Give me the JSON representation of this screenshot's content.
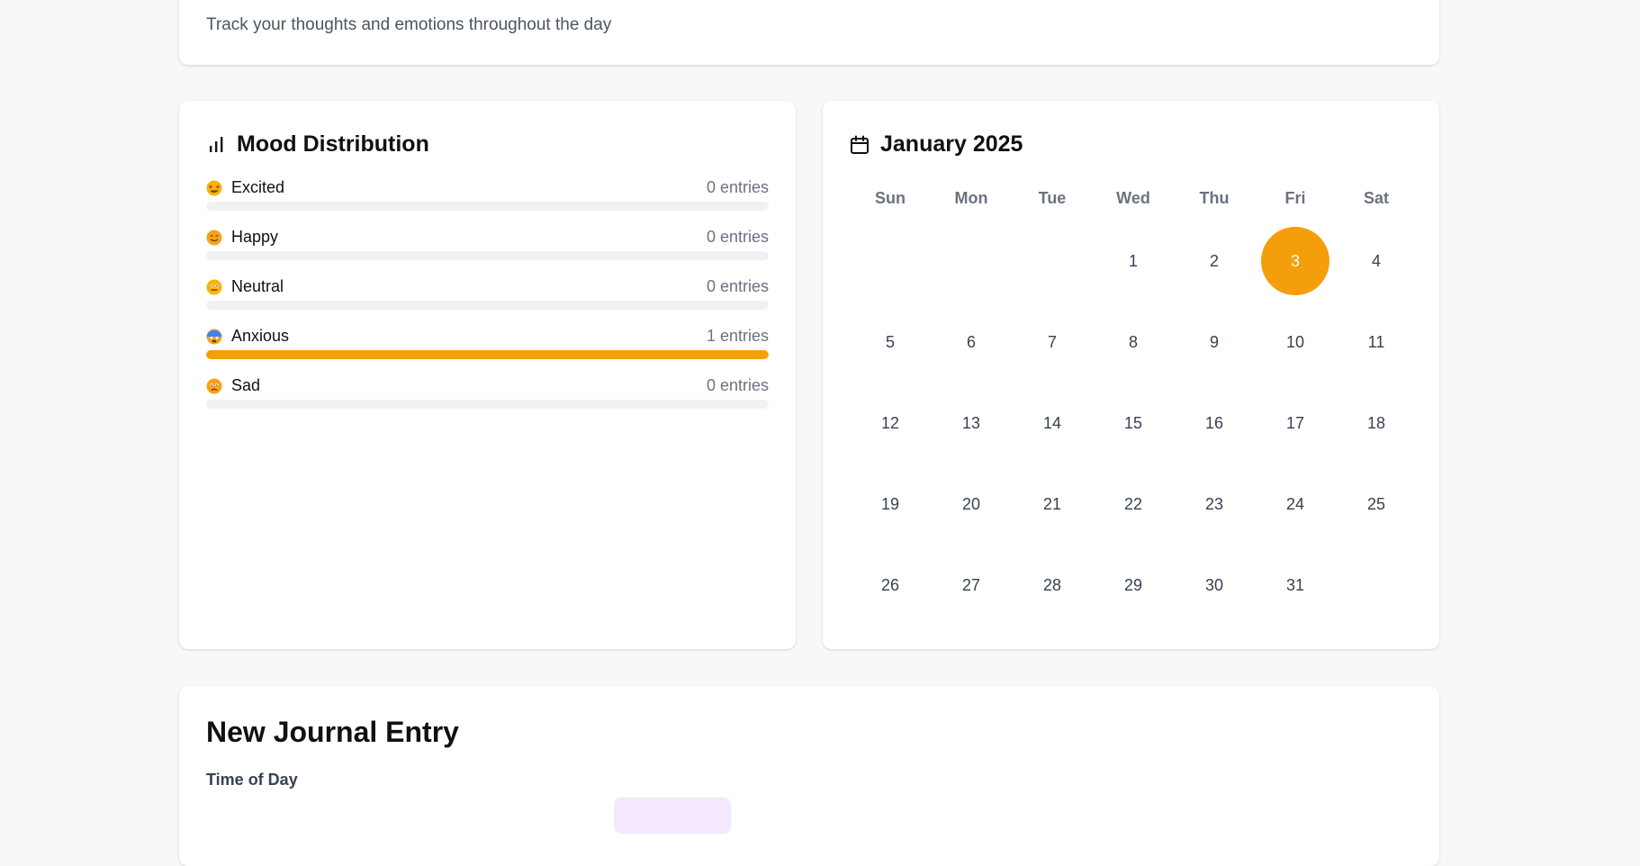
{
  "header": {
    "subtitle": "Track your thoughts and emotions throughout the day"
  },
  "mood_distribution": {
    "title": "Mood Distribution",
    "icon": "bar-chart-icon",
    "accent_color": "#f59e0b",
    "items": [
      {
        "label": "Excited",
        "count_text": "0 entries",
        "fraction": 0,
        "emoji_icon": "star-struck-emoji-icon"
      },
      {
        "label": "Happy",
        "count_text": "0 entries",
        "fraction": 0,
        "emoji_icon": "smiling-face-emoji-icon"
      },
      {
        "label": "Neutral",
        "count_text": "0 entries",
        "fraction": 0,
        "emoji_icon": "neutral-face-emoji-icon"
      },
      {
        "label": "Anxious",
        "count_text": "1 entries",
        "fraction": 1,
        "emoji_icon": "anxious-face-emoji-icon"
      },
      {
        "label": "Sad",
        "count_text": "0 entries",
        "fraction": 0,
        "emoji_icon": "sad-face-emoji-icon"
      }
    ]
  },
  "calendar": {
    "title": "January 2025",
    "icon": "calendar-icon",
    "weekdays": [
      "Sun",
      "Mon",
      "Tue",
      "Wed",
      "Thu",
      "Fri",
      "Sat"
    ],
    "first_weekday_index": 3,
    "days_in_month": 31,
    "selected_day": 3,
    "selected_color": "#f59e0b"
  },
  "new_entry": {
    "title": "New Journal Entry",
    "time_of_day_label": "Time of Day"
  }
}
